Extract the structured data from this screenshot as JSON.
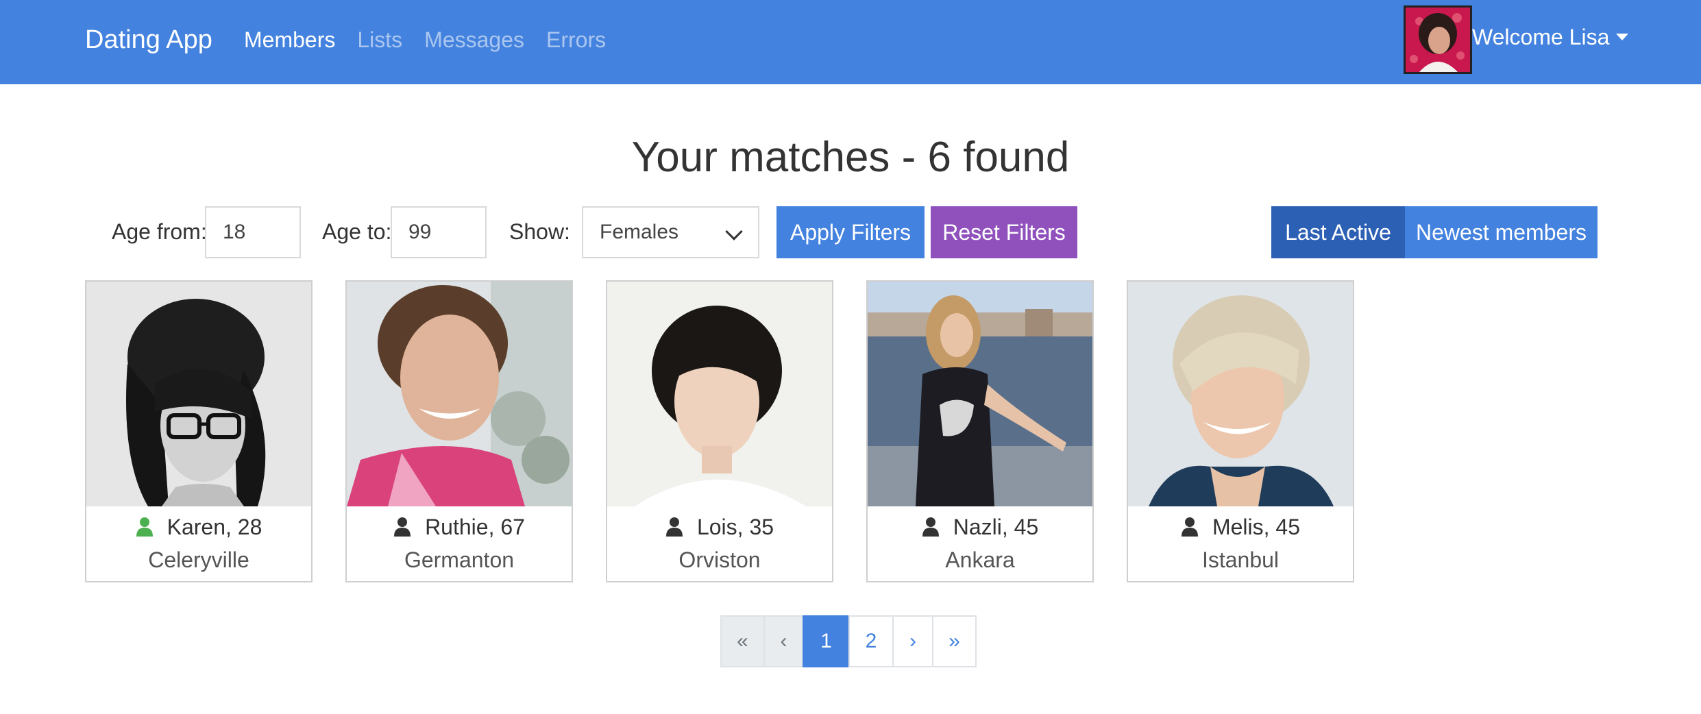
{
  "navbar": {
    "brand": "Dating App",
    "links": [
      {
        "label": "Members",
        "active": true
      },
      {
        "label": "Lists",
        "active": false
      },
      {
        "label": "Messages",
        "active": false
      },
      {
        "label": "Errors",
        "active": false
      }
    ],
    "welcome": "Welcome Lisa"
  },
  "page": {
    "title": "Your matches - 6 found"
  },
  "filters": {
    "age_from_label": "Age from:",
    "age_from_value": "18",
    "age_to_label": "Age to:",
    "age_to_value": "99",
    "show_label": "Show:",
    "show_value": "Females",
    "apply_label": "Apply Filters",
    "reset_label": "Reset Filters"
  },
  "sort": {
    "options": [
      {
        "label": "Last Active",
        "active": true
      },
      {
        "label": "Newest members",
        "active": false
      }
    ]
  },
  "members": [
    {
      "name": "Karen, 28",
      "city": "Celeryville",
      "online": true
    },
    {
      "name": "Ruthie, 67",
      "city": "Germanton",
      "online": false
    },
    {
      "name": "Lois, 35",
      "city": "Orviston",
      "online": false
    },
    {
      "name": "Nazli, 45",
      "city": "Ankara",
      "online": false
    },
    {
      "name": "Melis, 45",
      "city": "Istanbul",
      "online": false
    }
  ],
  "pagination": {
    "first": "«",
    "prev": "‹",
    "pages": [
      "1",
      "2"
    ],
    "current": "1",
    "next": "›",
    "last": "»"
  },
  "colors": {
    "primary": "#4382de",
    "purple": "#9051bd",
    "online": "#4caf50",
    "offline": "#333333"
  }
}
